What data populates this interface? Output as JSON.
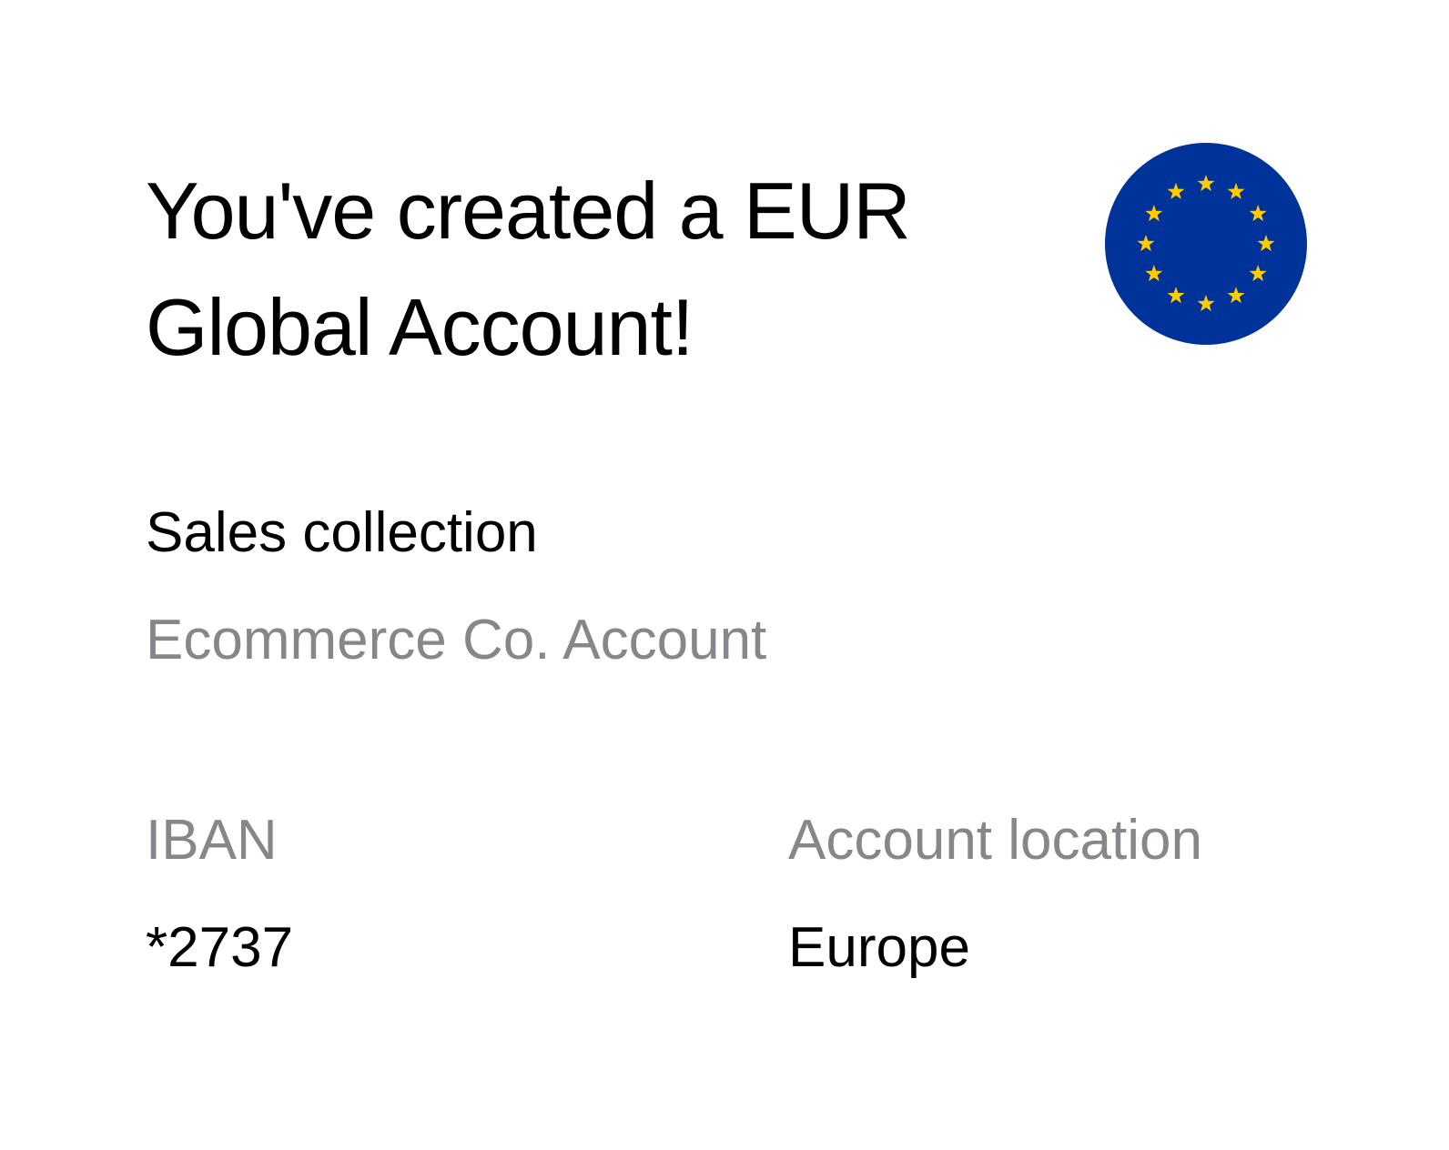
{
  "header": {
    "title": "You've created a EUR Global Account!",
    "flag_icon": "eu-flag-icon",
    "flag_colors": {
      "background": "#003399",
      "stars": "#FFCC00"
    }
  },
  "account": {
    "name": "Sales collection",
    "subtitle": "Ecommerce Co. Account"
  },
  "details": {
    "iban_label": "IBAN",
    "iban_value": "*2737",
    "location_label": "Account location",
    "location_value": "Europe"
  }
}
